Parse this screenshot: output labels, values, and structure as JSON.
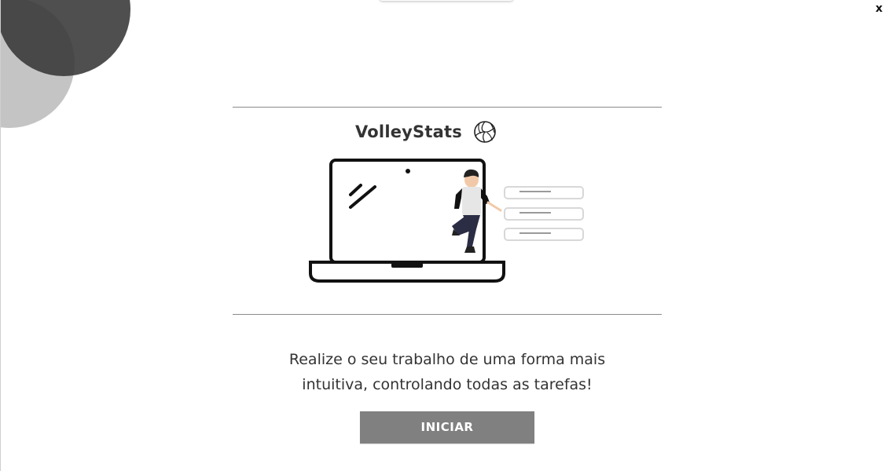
{
  "window": {
    "close_label": "x"
  },
  "brand": {
    "title": "VolleyStats",
    "icon": "volleyball-icon"
  },
  "illustration": {
    "subject": "person-with-laptop-and-task-list",
    "list_item_count": 3
  },
  "intro": {
    "line1": "Realize o seu trabalho de uma forma mais",
    "line2": "intuitiva, controlando todas as tarefas!"
  },
  "actions": {
    "start_label": "INICIAR"
  },
  "colors": {
    "accent_button": "#808080",
    "text": "#333333",
    "deco_dark": "#373737",
    "deco_light": "#c4c4c4"
  }
}
